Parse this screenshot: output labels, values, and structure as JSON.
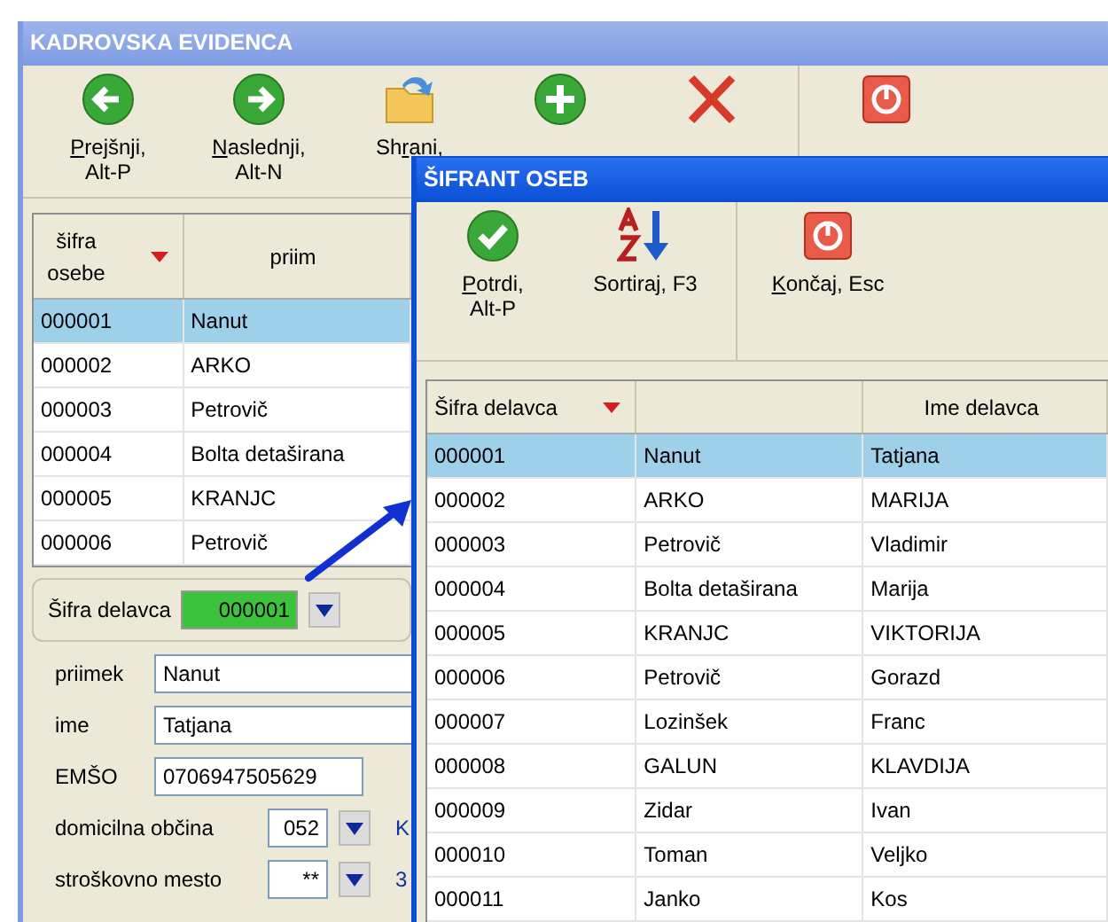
{
  "main_window": {
    "title": "KADROVSKA EVIDENCA",
    "toolbar": [
      {
        "kind": "prev",
        "label": {
          "key": "P",
          "after": "rejšnji,"
        },
        "shortcut": "Alt-P"
      },
      {
        "kind": "next",
        "label": {
          "key": "N",
          "after": "aslednji,"
        },
        "shortcut": "Alt-N"
      },
      {
        "kind": "save",
        "label": {
          "before": "Sh",
          "key": "r",
          "after": "ani,"
        }
      },
      {
        "kind": "add"
      },
      {
        "kind": "delete"
      },
      {
        "kind": "exit"
      }
    ],
    "grid": {
      "columns": [
        {
          "label": "šifra osebe",
          "sorted": true
        },
        {
          "label": "priim",
          "sorted": false
        }
      ],
      "rows": [
        {
          "cells": [
            "000001",
            "Nanut"
          ],
          "selected": true
        },
        {
          "cells": [
            "000002",
            "ARKO"
          ],
          "selected": false
        },
        {
          "cells": [
            "000003",
            "Petrovič"
          ],
          "selected": false
        },
        {
          "cells": [
            "000004",
            "Bolta detaširana"
          ],
          "selected": false
        },
        {
          "cells": [
            "000005",
            "KRANJC"
          ],
          "selected": false
        },
        {
          "cells": [
            "000006",
            "Petrovič"
          ],
          "selected": false
        }
      ]
    },
    "lookup": {
      "label": "Šifra delavca",
      "value": "000001"
    },
    "fields": [
      {
        "kind": "text",
        "label": "priimek",
        "value": "Nanut"
      },
      {
        "kind": "text",
        "label": "ime",
        "value": "Tatjana"
      },
      {
        "kind": "short",
        "label": "EMŠO",
        "value": "0706947505629"
      },
      {
        "kind": "combo",
        "label": "domicilna občina",
        "value": "052",
        "extra": "K"
      },
      {
        "kind": "combo",
        "label": "stroškovno mesto",
        "value": "**",
        "extra": "3"
      }
    ]
  },
  "dialog": {
    "title": "ŠIFRANT OSEB",
    "toolbar": [
      {
        "kind": "confirm",
        "label": {
          "key": "P",
          "after": "otrdi,"
        },
        "shortcut": "Alt-P"
      },
      {
        "kind": "sort",
        "label": {
          "before": "Sortiraj, F3"
        }
      },
      {
        "kind": "exit",
        "label": {
          "key": "K",
          "after": "ončaj, Esc"
        }
      }
    ],
    "grid": {
      "columns": [
        {
          "label": "Šifra delavca",
          "sorted": true
        },
        {
          "sorted": false
        },
        {
          "label": "Ime delavca",
          "sorted": false
        }
      ],
      "rows": [
        {
          "cells": [
            "000001",
            "Nanut",
            "Tatjana"
          ],
          "selected": true
        },
        {
          "cells": [
            "000002",
            "ARKO",
            "MARIJA"
          ],
          "selected": false
        },
        {
          "cells": [
            "000003",
            "Petrovič",
            "Vladimir"
          ],
          "selected": false
        },
        {
          "cells": [
            "000004",
            "Bolta detaširana",
            "Marija"
          ],
          "selected": false
        },
        {
          "cells": [
            "000005",
            "KRANJC",
            "VIKTORIJA"
          ],
          "selected": false
        },
        {
          "cells": [
            "000006",
            "Petrovič",
            "Gorazd"
          ],
          "selected": false
        },
        {
          "cells": [
            "000007",
            "Lozinšek",
            "Franc"
          ],
          "selected": false
        },
        {
          "cells": [
            "000008",
            "GALUN",
            "KLAVDIJA"
          ],
          "selected": false
        },
        {
          "cells": [
            "000009",
            "Zidar",
            "Ivan"
          ],
          "selected": false
        },
        {
          "cells": [
            "000010",
            "Toman",
            "Veljko"
          ],
          "selected": false
        },
        {
          "cells": [
            "000011",
            "Janko",
            "Kos"
          ],
          "selected": false
        }
      ]
    }
  }
}
